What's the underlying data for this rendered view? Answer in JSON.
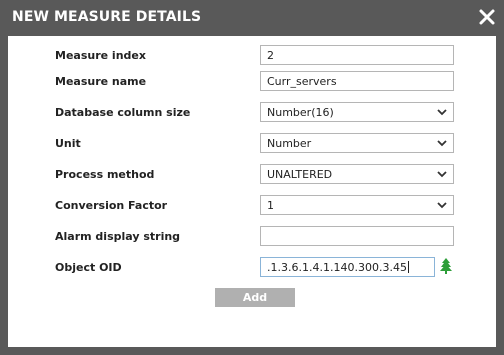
{
  "dialog": {
    "title": "NEW MEASURE DETAILS",
    "close_icon": "close-icon"
  },
  "fields": [
    {
      "label": "Measure index",
      "value": "2",
      "type": "text"
    },
    {
      "label": "Measure name",
      "value": "Curr_servers",
      "type": "text"
    },
    {
      "label": "Database column size",
      "value": "Number(16)",
      "type": "select"
    },
    {
      "label": "Unit",
      "value": "Number",
      "type": "select"
    },
    {
      "label": "Process method",
      "value": "UNALTERED",
      "type": "select"
    },
    {
      "label": "Conversion Factor",
      "value": "1",
      "type": "select"
    },
    {
      "label": "Alarm display string",
      "value": "",
      "type": "text"
    },
    {
      "label": "Object OID",
      "value": ".1.3.6.1.4.1.140.300.3.45",
      "type": "text"
    }
  ],
  "oid_browse_icon": "tree-icon",
  "add_button": {
    "label": "Add"
  },
  "colors": {
    "title_bar": "#595959",
    "tree_icon": "#2e9e3a",
    "add_button_bg": "#b0b0b0"
  }
}
